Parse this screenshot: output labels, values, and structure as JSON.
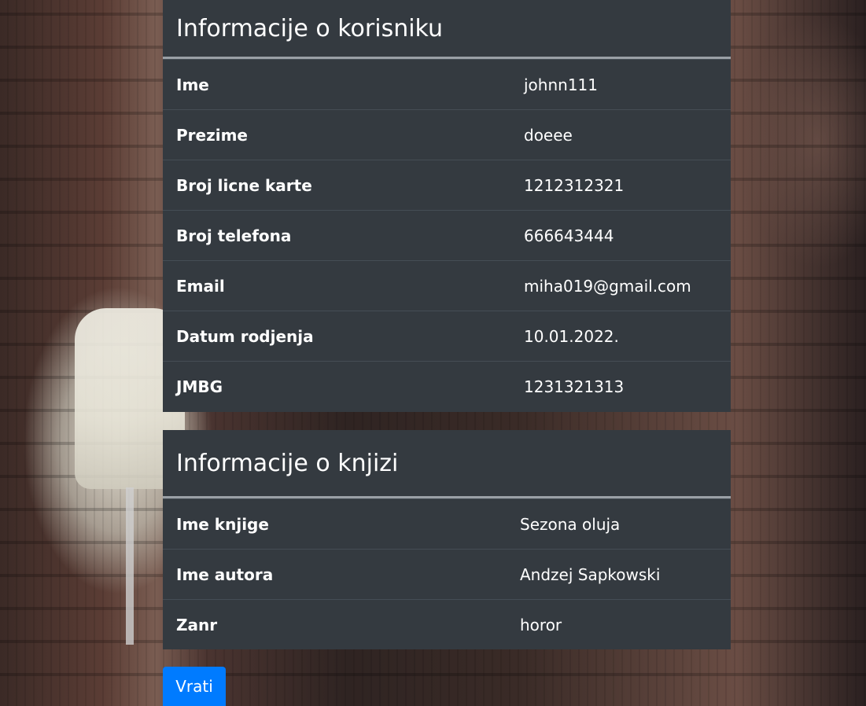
{
  "user_section": {
    "title": "Informacije o korisniku",
    "rows": [
      {
        "label": "Ime",
        "value": "johnn111"
      },
      {
        "label": "Prezime",
        "value": "doeee"
      },
      {
        "label": "Broj licne karte",
        "value": "1212312321"
      },
      {
        "label": "Broj telefona",
        "value": "666643444"
      },
      {
        "label": "Email",
        "value": "miha019@gmail.com"
      },
      {
        "label": "Datum rodjenja",
        "value": "10.01.2022."
      },
      {
        "label": "JMBG",
        "value": "1231321313"
      }
    ]
  },
  "book_section": {
    "title": "Informacije o knjizi",
    "rows": [
      {
        "label": "Ime knjige",
        "value": "Sezona oluja"
      },
      {
        "label": "Ime autora",
        "value": "Andzej Sapkowski"
      },
      {
        "label": "Zanr",
        "value": "horor"
      }
    ]
  },
  "back_button": {
    "label": "Vrati"
  },
  "colors": {
    "panel_bg": "#343a40",
    "divider": "#454d55",
    "button_bg": "#007bff"
  }
}
